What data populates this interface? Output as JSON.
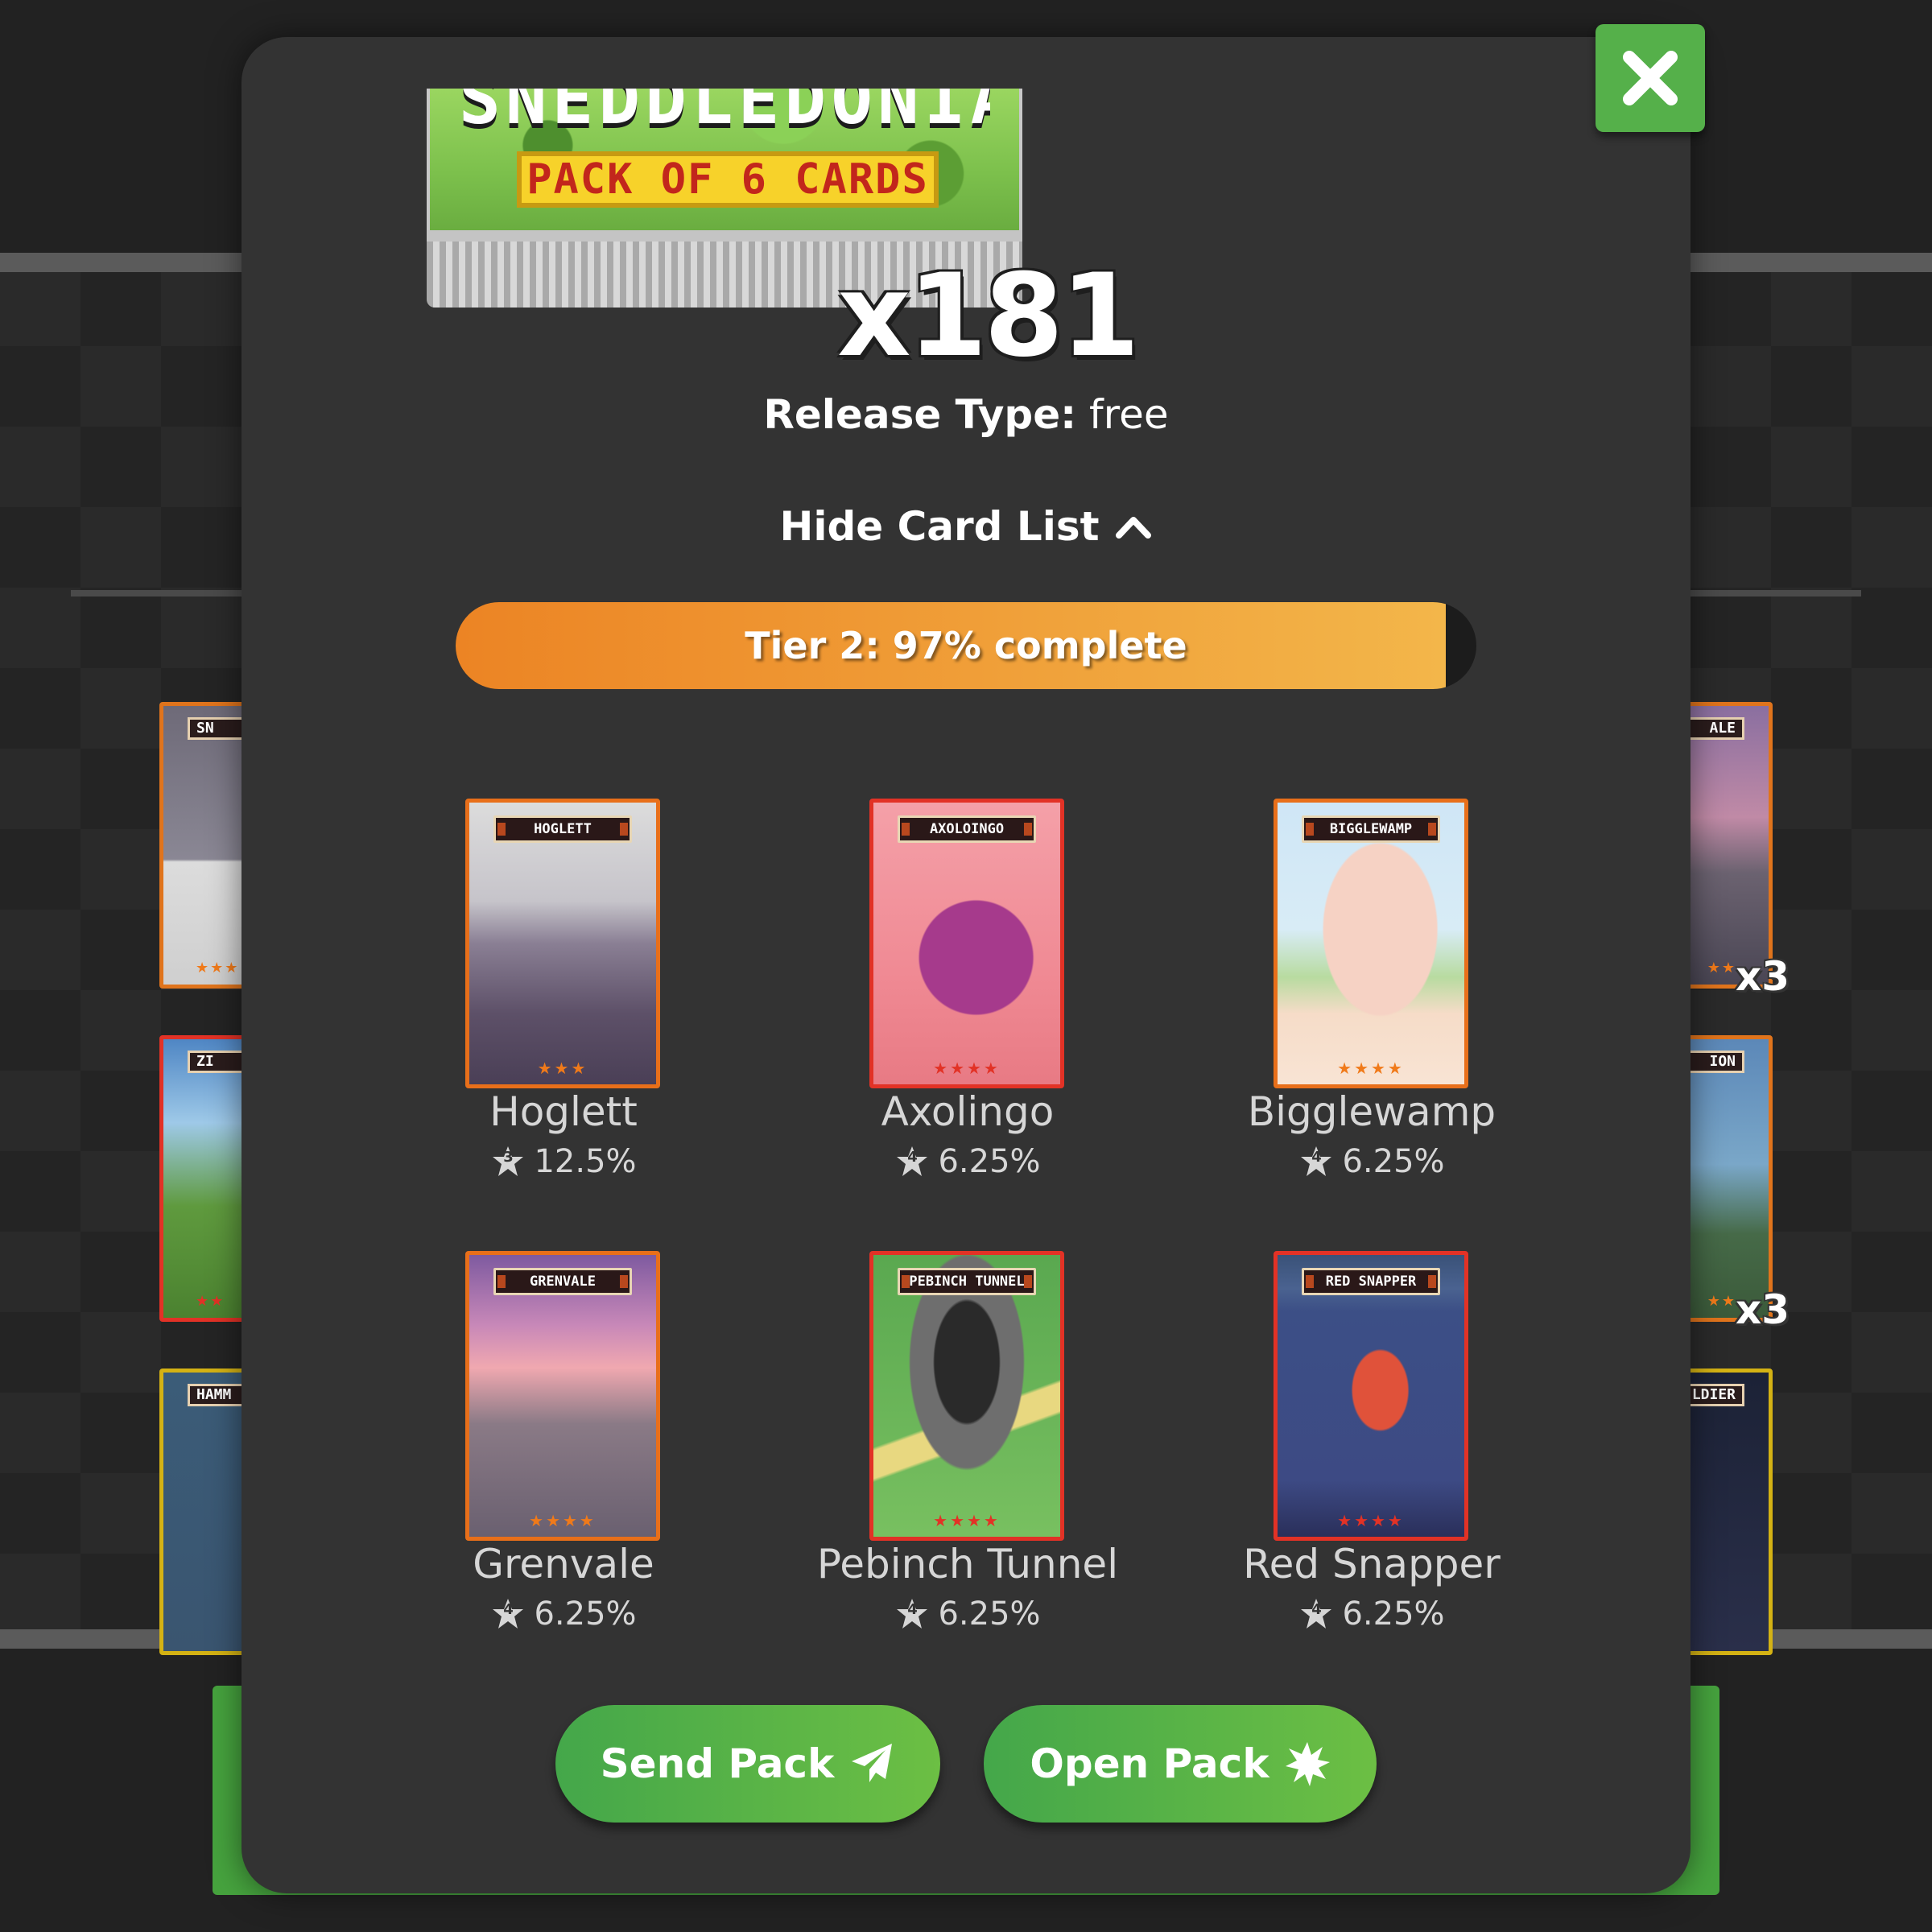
{
  "pack": {
    "name_fragment": "SNEDDLEDONIA",
    "label": "PACK OF 6 CARDS",
    "count": "x181"
  },
  "release": {
    "label": "Release Type:",
    "value": "free"
  },
  "card_list_toggle": {
    "label": "Hide Card List",
    "icon": "chevron-up-icon"
  },
  "progress": {
    "label": "Tier 2: 97% complete",
    "percent": 97
  },
  "cards": [
    {
      "name": "Hoglett",
      "banner": "HOGLETT",
      "tier": "3",
      "rate": "12.5%",
      "rarity_color": "#e86f1a",
      "stars": "★★★"
    },
    {
      "name": "Axolingo",
      "banner": "AXOLOINGO",
      "tier": "4",
      "rate": "6.25%",
      "rarity_color": "#e23226",
      "stars": "★★★★"
    },
    {
      "name": "Bigglewamp",
      "banner": "BIGGLEWAMP",
      "tier": "4",
      "rate": "6.25%",
      "rarity_color": "#e86f1a",
      "stars": "★★★★"
    },
    {
      "name": "Grenvale",
      "banner": "GRENVALE",
      "tier": "4",
      "rate": "6.25%",
      "rarity_color": "#e86f1a",
      "stars": "★★★★"
    },
    {
      "name": "Pebinch Tunnel",
      "banner": "PEBINCH TUNNEL",
      "tier": "4",
      "rate": "6.25%",
      "rarity_color": "#e23226",
      "stars": "★★★★"
    },
    {
      "name": "Red Snapper",
      "banner": "RED SNAPPER",
      "tier": "4",
      "rate": "6.25%",
      "rarity_color": "#e23226",
      "stars": "★★★★"
    }
  ],
  "actions": {
    "send": {
      "label": "Send Pack",
      "icon": "paper-plane-icon"
    },
    "open": {
      "label": "Open Pack",
      "icon": "burst-icon"
    }
  },
  "background": {
    "cards_left": [
      "SN",
      "ZI",
      "HAMM"
    ],
    "cards_right": [
      "ALE",
      "ION",
      "LDIER"
    ],
    "counts": [
      "x3",
      "x3"
    ]
  },
  "colors": {
    "accent_green": "#55b04a",
    "progress_start": "#ec8424",
    "progress_end": "#f3b64a",
    "modal_bg": "#333333"
  }
}
